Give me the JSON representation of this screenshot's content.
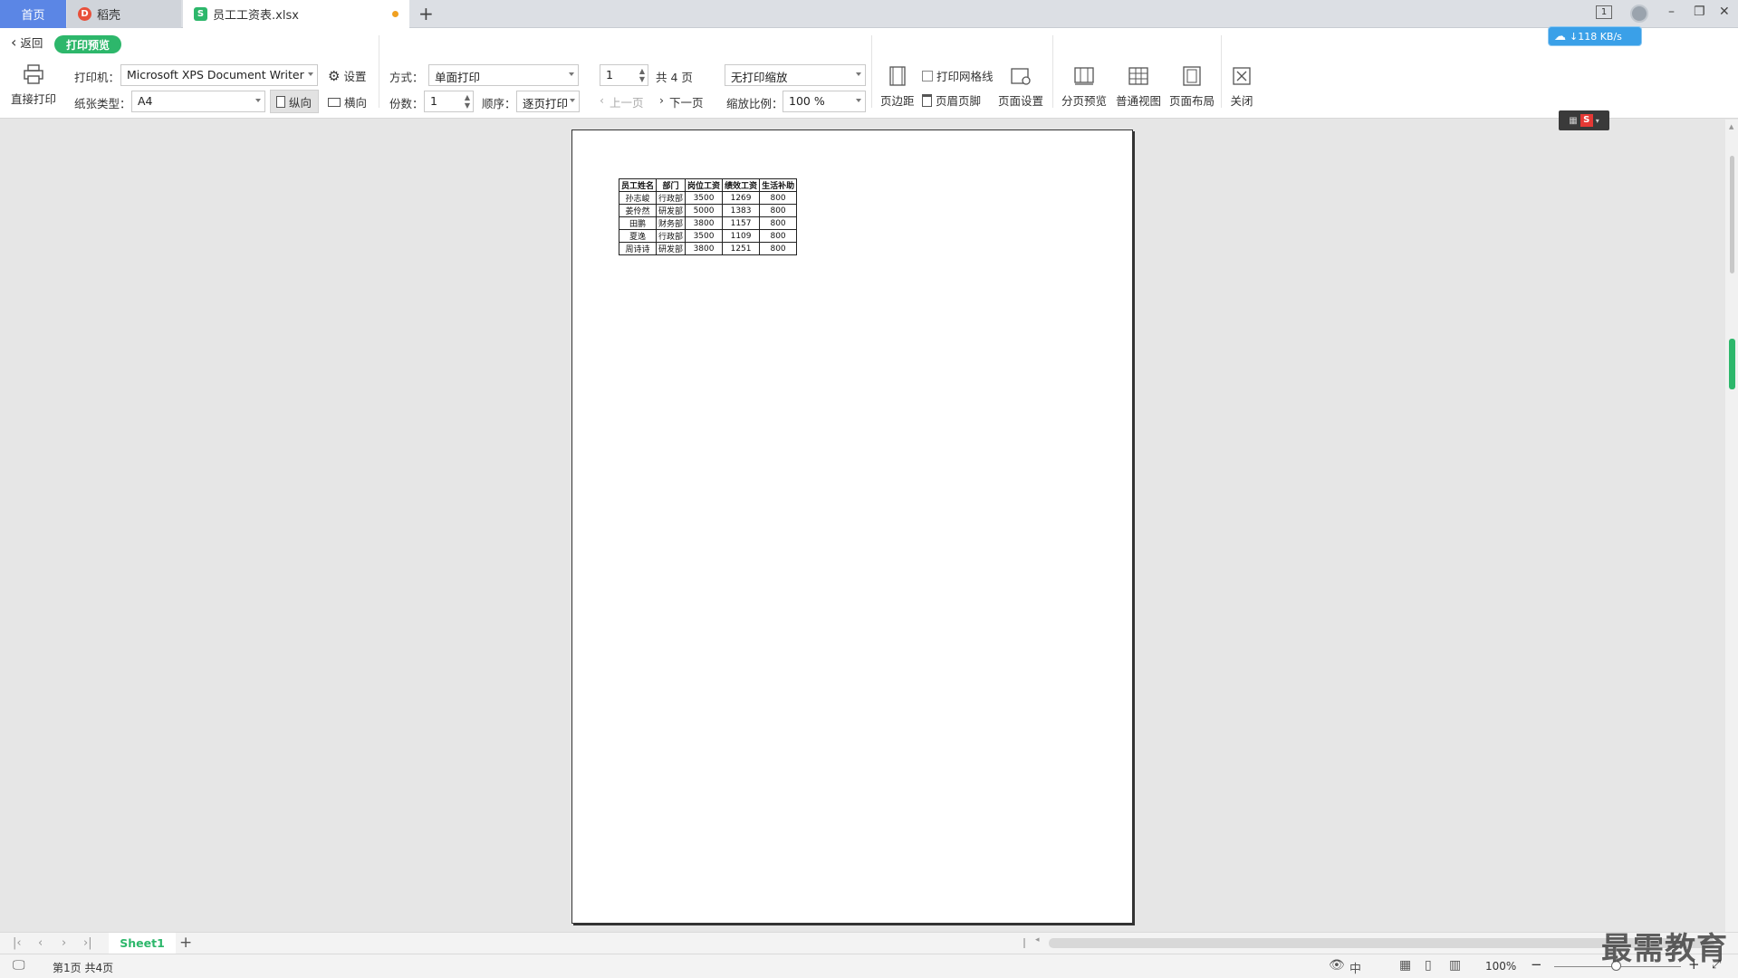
{
  "tabs": {
    "home": "首页",
    "docer": "稻壳",
    "file": "员工工资表.xlsx",
    "add": "+"
  },
  "window_controls": {
    "page_badge": "1",
    "minimize": "–",
    "restore": "❐",
    "close": "✕"
  },
  "speed_badge": "↓118 KB/s",
  "toolbar": {
    "back": "返回",
    "mode_badge": "打印预览",
    "direct_print": "直接打印",
    "printer_label": "打印机：",
    "printer_value": "Microsoft XPS Document Writer",
    "settings": "设置",
    "paper_label": "纸张类型：",
    "paper_value": "A4",
    "portrait": "纵向",
    "landscape": "横向",
    "method_label": "方式：",
    "method_value": "单面打印",
    "copies_label": "份数：",
    "copies_value": "1",
    "order_label": "顺序：",
    "order_value": "逐页打印",
    "page_value": "1",
    "page_total": "共 4 页",
    "prev_page": "上一页",
    "next_page": "下一页",
    "scale_mode_value": "无打印缩放",
    "zoom_label": "缩放比例：",
    "zoom_value": "100 %",
    "print_gridlines": "打印网格线",
    "margins": "页边距",
    "header_footer": "页眉页脚",
    "page_setup": "页面设置",
    "page_break_preview": "分页预览",
    "normal_view": "普通视图",
    "page_layout": "页面布局",
    "close": "关闭"
  },
  "table": {
    "headers": [
      "员工姓名",
      "部门",
      "岗位工资",
      "绩效工资",
      "生活补助"
    ],
    "rows": [
      [
        "孙志峻",
        "行政部",
        "3500",
        "1269",
        "800"
      ],
      [
        "姜伶然",
        "研发部",
        "5000",
        "1383",
        "800"
      ],
      [
        "田鹏",
        "财务部",
        "3800",
        "1157",
        "800"
      ],
      [
        "夏逸",
        "行政部",
        "3500",
        "1109",
        "800"
      ],
      [
        "周诗诗",
        "研发部",
        "3800",
        "1251",
        "800"
      ]
    ]
  },
  "sheet_tab": "Sheet1",
  "status": {
    "page_info": "第1页 共4页",
    "zoom": "100%",
    "ime": "中"
  },
  "watermark": "最需教育",
  "colors": {
    "accent_green": "#2db76b",
    "home_tab_blue": "#5b86e5",
    "badge_blue": "#3aa0e8"
  }
}
